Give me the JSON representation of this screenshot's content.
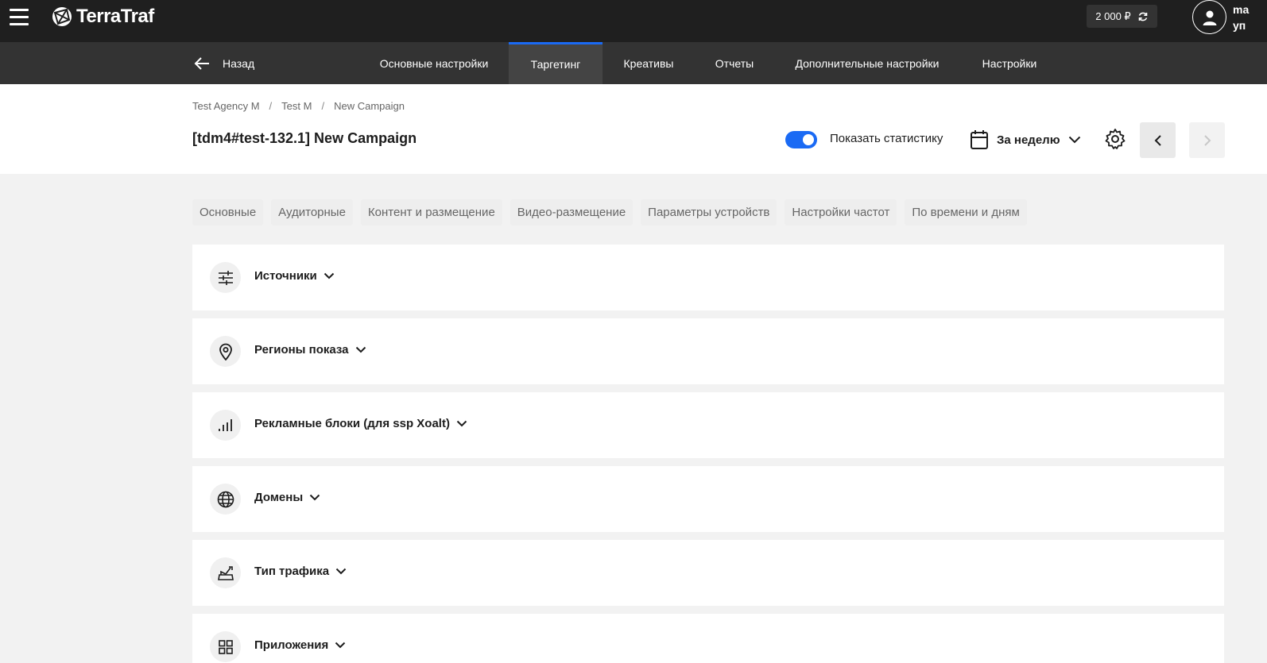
{
  "app": {
    "logo_text": "TerraTraf"
  },
  "topbar": {
    "balance": "2 000 ₽",
    "user_line1": "ma",
    "user_line2": "уп"
  },
  "navbar": {
    "back_label": "Назад",
    "tabs": [
      {
        "label": "Основные настройки",
        "active": false
      },
      {
        "label": "Таргетинг",
        "active": true
      },
      {
        "label": "Креативы",
        "active": false
      },
      {
        "label": "Отчеты",
        "active": false
      },
      {
        "label": "Дополнительные настройки",
        "active": false
      },
      {
        "label": "Настройки",
        "active": false
      }
    ]
  },
  "breadcrumb": {
    "items": [
      "Test Agency M",
      "Test M",
      "New Campaign"
    ],
    "separator": "/"
  },
  "page": {
    "title": "[tdm4#test-132.1] New Campaign",
    "show_stats_label": "Показать статистику",
    "show_stats_enabled": true,
    "period_label": "За неделю"
  },
  "subtabs": [
    "Основные",
    "Аудиторные",
    "Контент и размещение",
    "Видео-размещение",
    "Параметры устройств",
    "Настройки частот",
    "По времени и дням"
  ],
  "sections": [
    {
      "title": "Источники",
      "icon": "sliders-icon"
    },
    {
      "title": "Регионы показа",
      "icon": "map-pin-icon"
    },
    {
      "title": "Рекламные блоки (для ssp Xoalt)",
      "icon": "bar-chart-icon"
    },
    {
      "title": "Домены",
      "icon": "globe-icon"
    },
    {
      "title": "Тип трафика",
      "icon": "traffic-icon"
    },
    {
      "title": "Приложения",
      "icon": "grid-icon"
    }
  ],
  "colors": {
    "accent": "#1a6af4",
    "topbar": "#1f1f1f",
    "navbar": "#333333",
    "background": "#f2f2f2"
  }
}
